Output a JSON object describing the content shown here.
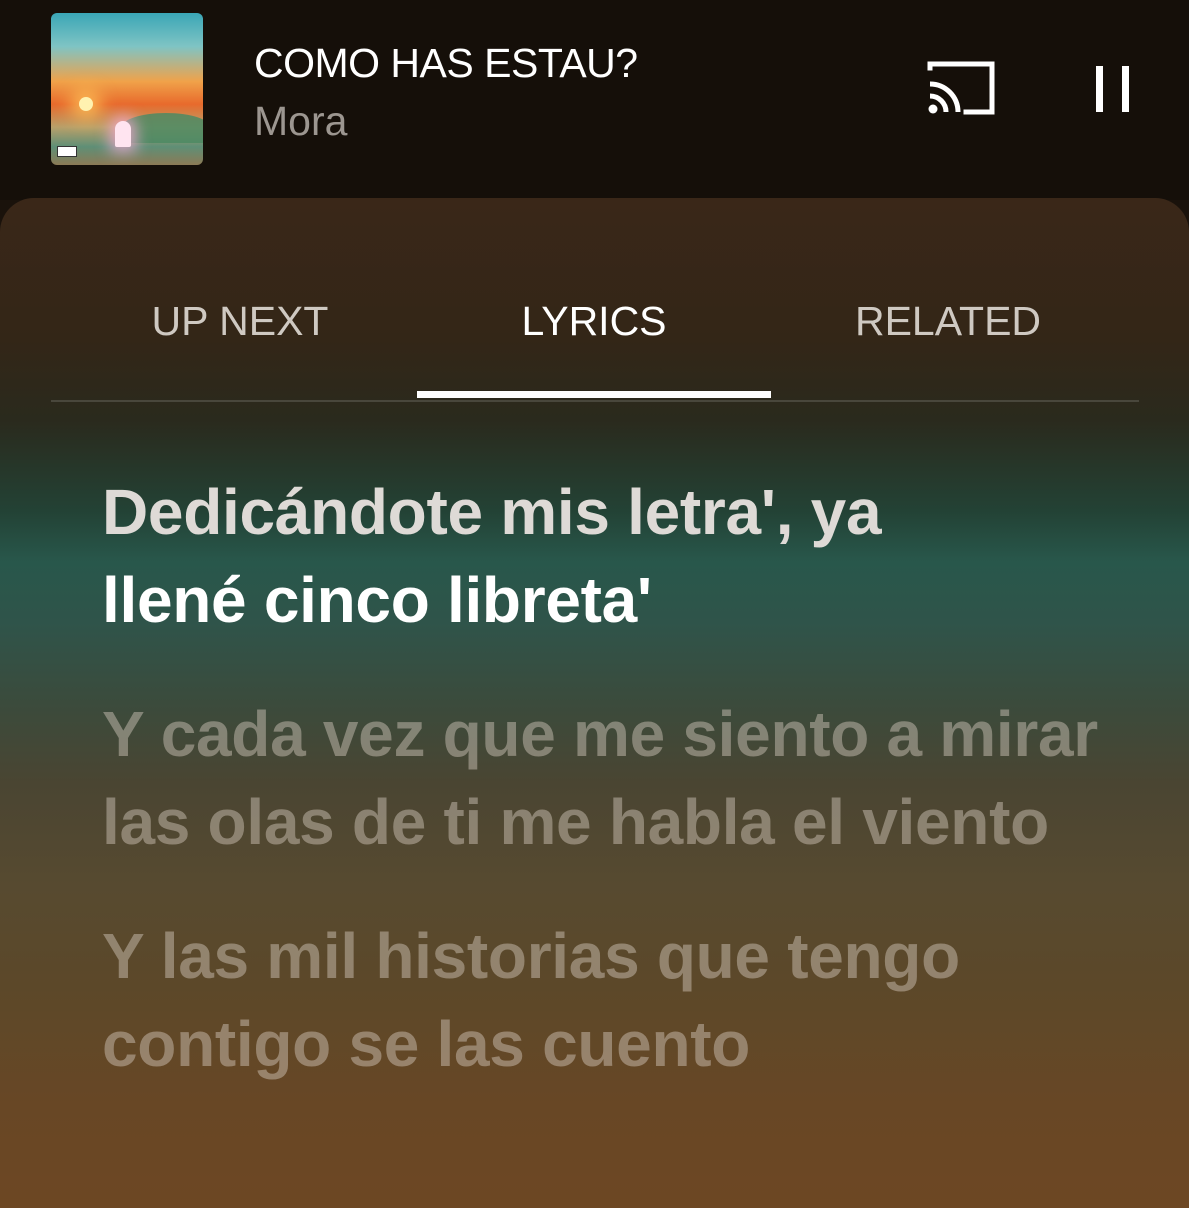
{
  "now_playing": {
    "title": "COMO HAS ESTAU?",
    "artist": "Mora",
    "album_art_icon": "album-art-sunset",
    "cast_icon": "cast-icon",
    "pause_icon": "pause-icon"
  },
  "tabs": [
    {
      "label": "UP NEXT",
      "active": false
    },
    {
      "label": "LYRICS",
      "active": true
    },
    {
      "label": "RELATED",
      "active": false
    }
  ],
  "lyrics": {
    "current_line_part1": "Dedicándote mis letra', ya",
    "current_line_part2": "llené cinco libreta'",
    "upcoming": [
      "Y cada vez que me siento a mirar las olas de ti me habla el viento",
      "Y las mil historias que tengo contigo se las cuento"
    ]
  },
  "colors": {
    "background": "#150f09",
    "panel_top": "#3a2718",
    "panel_mid": "#28574b",
    "panel_bottom": "#6d4723",
    "active_text": "#ffffff",
    "inactive_tab_text": "#cfc9c2"
  }
}
